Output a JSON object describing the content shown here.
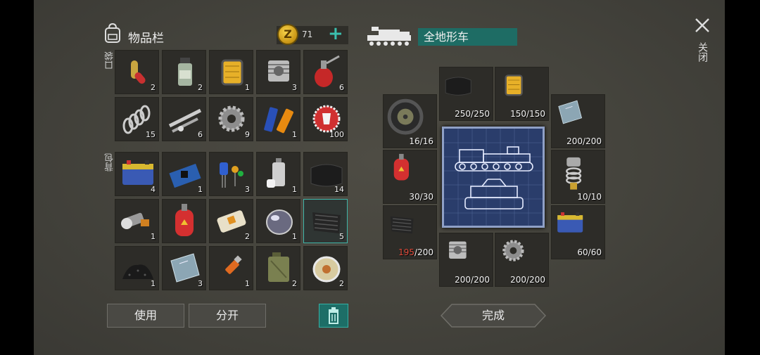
{
  "inventory": {
    "title": "物品栏",
    "coins": "71",
    "coin_symbol": "Z",
    "add_icon": "plus-icon",
    "pocket_label": "口袋",
    "backpack_label": "背包",
    "pocket_items": [
      {
        "name": "pills-capsule",
        "qty": "2"
      },
      {
        "name": "medicine-bottle",
        "qty": "2"
      },
      {
        "name": "oil-filter",
        "qty": "1"
      },
      {
        "name": "engine-cylinder",
        "qty": "3"
      },
      {
        "name": "oil-can",
        "qty": "6"
      },
      {
        "name": "spring",
        "qty": "15"
      },
      {
        "name": "metal-rods",
        "qty": "6"
      },
      {
        "name": "gear",
        "qty": "9"
      },
      {
        "name": "batteries",
        "qty": "1"
      },
      {
        "name": "bottle-cap",
        "qty": "100"
      }
    ],
    "backpack_items": [
      {
        "name": "car-battery",
        "qty": "4"
      },
      {
        "name": "circuit-board",
        "qty": "1"
      },
      {
        "name": "electronic-components",
        "qty": "3"
      },
      {
        "name": "spray-can",
        "qty": "1"
      },
      {
        "name": "rubber-sheet",
        "qty": "14"
      },
      {
        "name": "flashlight",
        "qty": "1"
      },
      {
        "name": "gas-cylinder",
        "qty": ""
      },
      {
        "name": "eraser",
        "qty": "2"
      },
      {
        "name": "glass-lens",
        "qty": "1"
      },
      {
        "name": "tread-plate",
        "qty": "5",
        "selected": true
      },
      {
        "name": "coal-pile",
        "qty": "1"
      },
      {
        "name": "glass-panel",
        "qty": "3"
      },
      {
        "name": "usb-stick",
        "qty": "1"
      },
      {
        "name": "jerry-can",
        "qty": "2"
      },
      {
        "name": "wire-spool",
        "qty": "2"
      }
    ],
    "buttons": {
      "use": "使用",
      "split": "分开",
      "trash_icon": "trash-icon"
    }
  },
  "crafting": {
    "vehicle_name": "全地形车",
    "vehicle_icon": "tank-icon",
    "slots": [
      {
        "name": "rubber-sheet",
        "have": "250",
        "need": "250"
      },
      {
        "name": "oil-filter",
        "have": "150",
        "need": "150"
      },
      {
        "name": "wheel",
        "have": "16",
        "need": "16"
      },
      {
        "name": "glass-panel",
        "have": "200",
        "need": "200"
      },
      {
        "name": "gas-cylinder",
        "have": "30",
        "need": "30"
      },
      {
        "name": "shock-absorber",
        "have": "10",
        "need": "10"
      },
      {
        "name": "tread-plate",
        "have": "195",
        "need": "200",
        "short": true
      },
      {
        "name": "car-battery",
        "have": "60",
        "need": "60"
      },
      {
        "name": "engine-cylinder",
        "have": "200",
        "need": "200"
      },
      {
        "name": "gear",
        "have": "200",
        "need": "200"
      }
    ],
    "done_label": "完成"
  },
  "window": {
    "close_label": "关闭",
    "close_icon": "close-icon"
  },
  "colors": {
    "accent": "#3bbfae",
    "teal_bg": "#1e6c64",
    "short_red": "#e04a3a"
  }
}
